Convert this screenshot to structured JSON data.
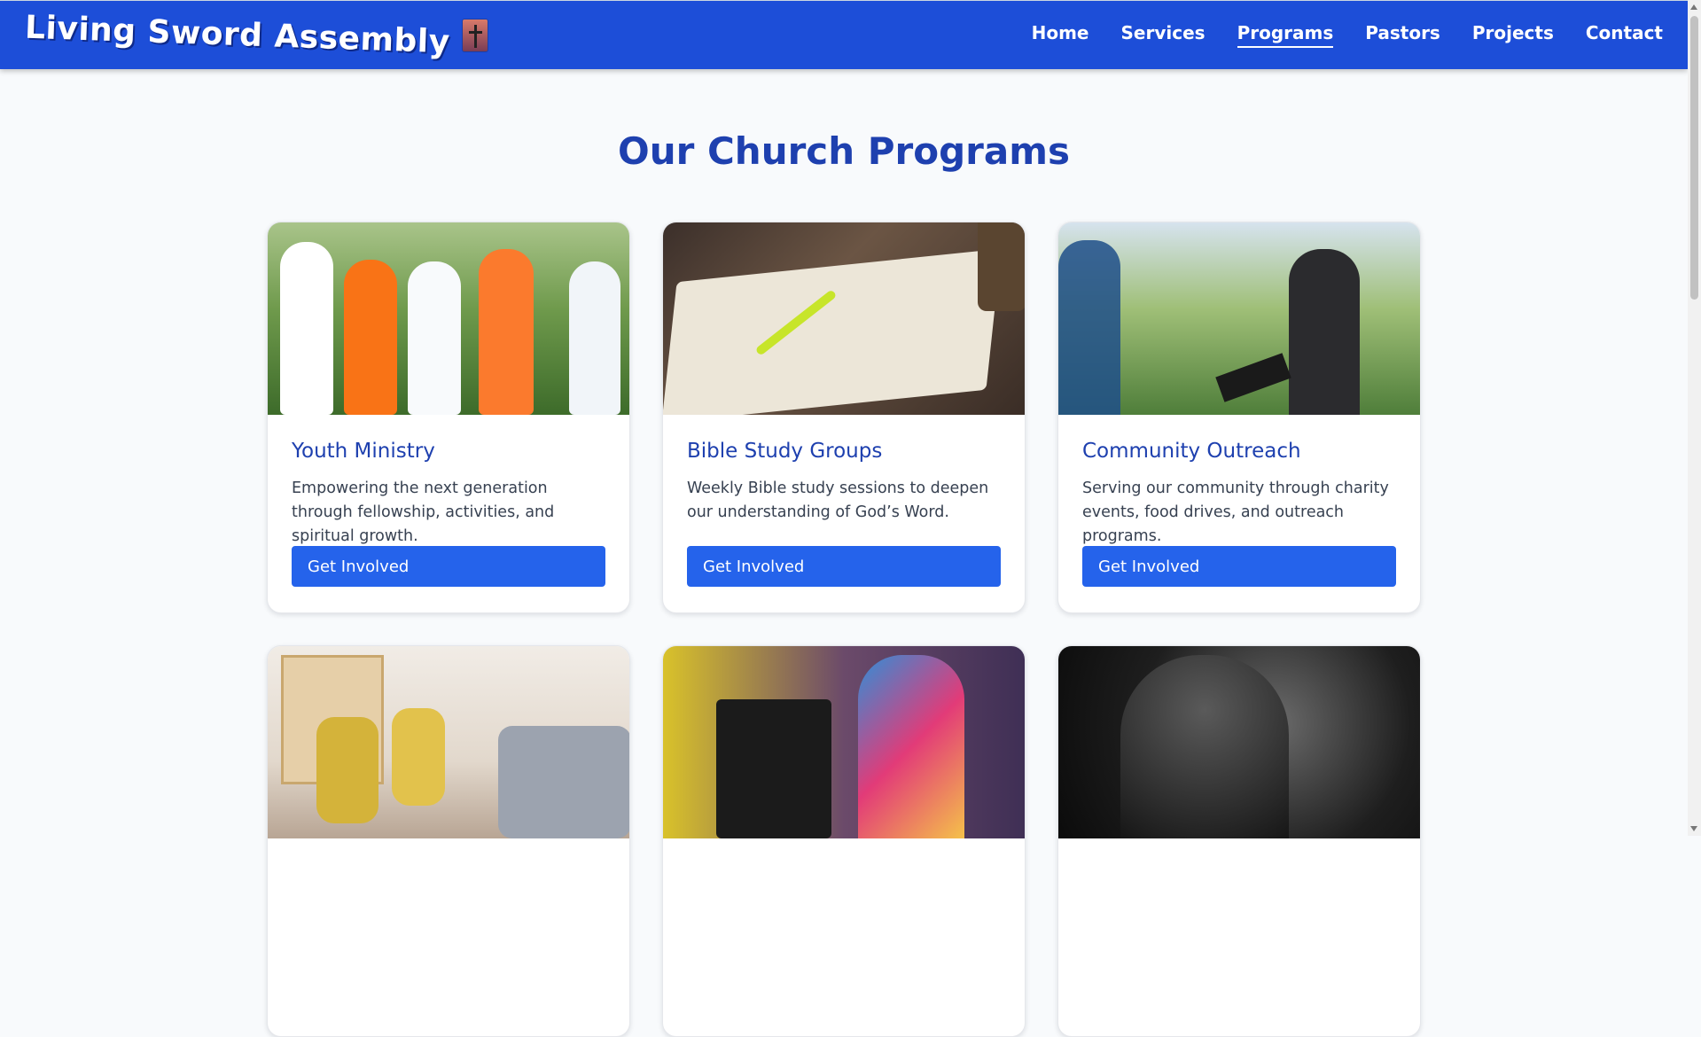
{
  "header": {
    "brand": "Living Sword Assembly",
    "nav": [
      {
        "label": "Home",
        "active": false
      },
      {
        "label": "Services",
        "active": false
      },
      {
        "label": "Programs",
        "active": true
      },
      {
        "label": "Pastors",
        "active": false
      },
      {
        "label": "Projects",
        "active": false
      },
      {
        "label": "Contact",
        "active": false
      }
    ]
  },
  "main": {
    "title": "Our Church Programs",
    "programs": [
      {
        "title": "Youth Ministry",
        "description": "Empowering the next generation through fellowship, activities, and spiritual growth.",
        "button": "Get Involved"
      },
      {
        "title": "Bible Study Groups",
        "description": "Weekly Bible study sessions to deepen our understanding of God’s Word.",
        "button": "Get Involved"
      },
      {
        "title": "Community Outreach",
        "description": "Serving our community through charity events, food drives, and outreach programs.",
        "button": "Get Involved"
      }
    ]
  },
  "colors": {
    "nav_bg": "#1d4ed8",
    "accent": "#2563eb",
    "title": "#1e40af"
  }
}
